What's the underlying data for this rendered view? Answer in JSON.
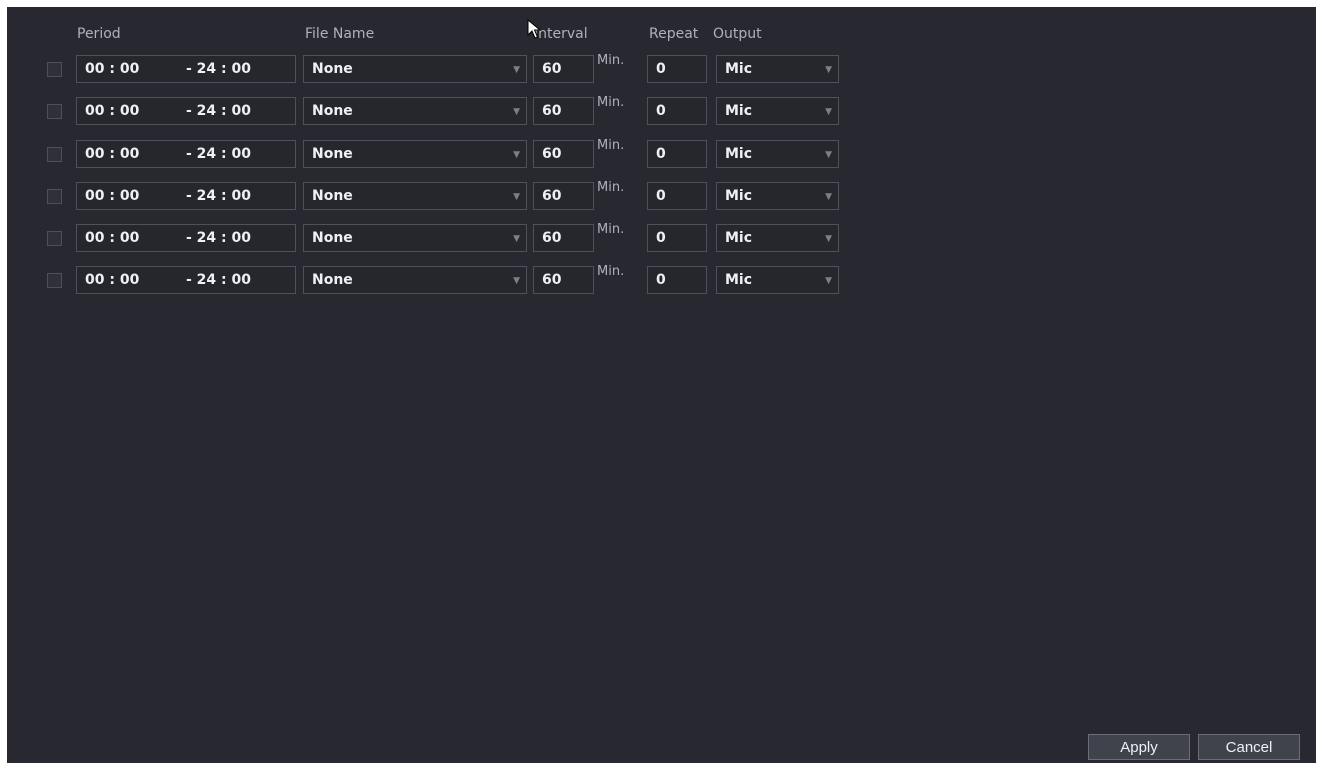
{
  "headers": {
    "period": "Period",
    "file_name": "File Name",
    "interval": "Interval",
    "repeat": "Repeat",
    "output": "Output"
  },
  "rows": [
    {
      "checked": false,
      "start": "00 : 00",
      "end": "- 24 : 00",
      "file": "None",
      "interval": "60",
      "unit": "Min.",
      "repeat": "0",
      "output": "Mic"
    },
    {
      "checked": false,
      "start": "00 : 00",
      "end": "- 24 : 00",
      "file": "None",
      "interval": "60",
      "unit": "Min.",
      "repeat": "0",
      "output": "Mic"
    },
    {
      "checked": false,
      "start": "00 : 00",
      "end": "- 24 : 00",
      "file": "None",
      "interval": "60",
      "unit": "Min.",
      "repeat": "0",
      "output": "Mic"
    },
    {
      "checked": false,
      "start": "00 : 00",
      "end": "- 24 : 00",
      "file": "None",
      "interval": "60",
      "unit": "Min.",
      "repeat": "0",
      "output": "Mic"
    },
    {
      "checked": false,
      "start": "00 : 00",
      "end": "- 24 : 00",
      "file": "None",
      "interval": "60",
      "unit": "Min.",
      "repeat": "0",
      "output": "Mic"
    },
    {
      "checked": false,
      "start": "00 : 00",
      "end": "- 24 : 00",
      "file": "None",
      "interval": "60",
      "unit": "Min.",
      "repeat": "0",
      "output": "Mic"
    }
  ],
  "buttons": {
    "apply": "Apply",
    "cancel": "Cancel"
  },
  "icons": {
    "dropdown": "chevron-down-icon",
    "cursor": "mouse-pointer-icon"
  },
  "colors": {
    "panel_bg": "#282930",
    "field_border": "#4f515a",
    "text": "#eef0f5"
  }
}
